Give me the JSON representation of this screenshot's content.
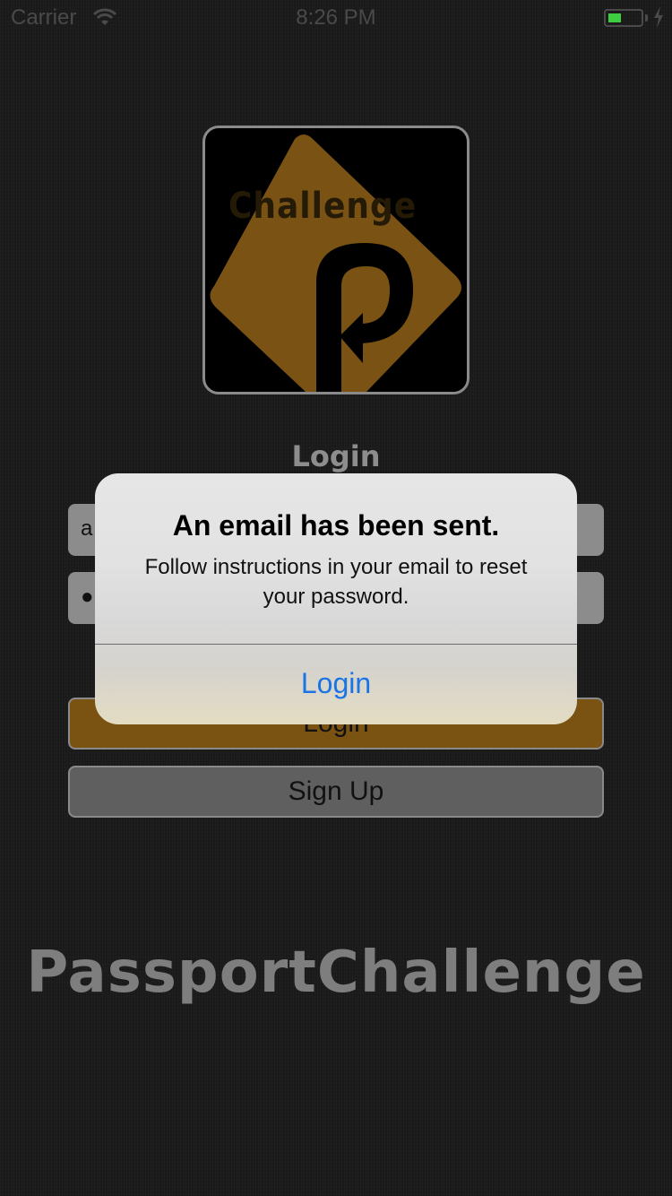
{
  "status_bar": {
    "carrier": "Carrier",
    "time": "8:26 PM",
    "battery_color": "#3ecd3e"
  },
  "logo": {
    "text": "Challenge",
    "diamond_color": "#7a5314",
    "icon": "passport-challenge-logo"
  },
  "login_form": {
    "title": "Login",
    "email_value": "a",
    "password_value": "●",
    "login_button": "Login",
    "signup_button": "Sign Up"
  },
  "brand": {
    "name": "PassportChallenge"
  },
  "alert": {
    "title": "An email has been sent.",
    "message": "Follow instructions in your email to reset your password.",
    "button": "Login",
    "button_color": "#1a74e6"
  }
}
